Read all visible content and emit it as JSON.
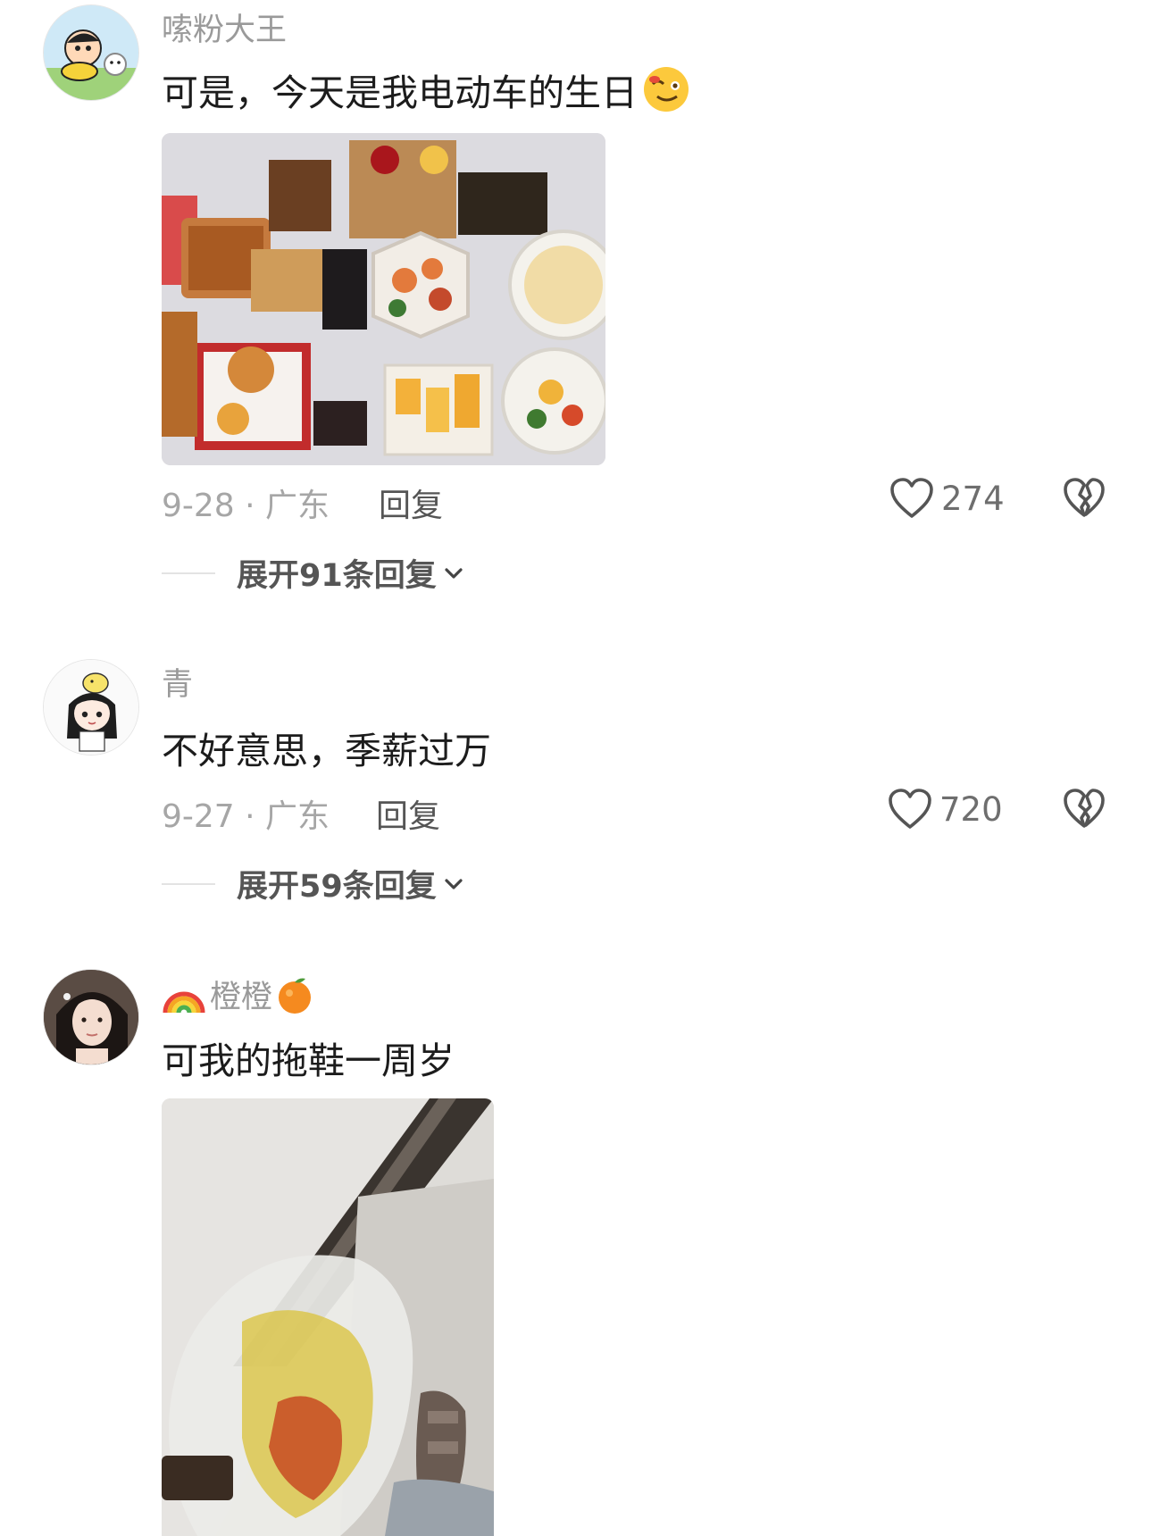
{
  "comments": [
    {
      "username": "嗦粉大王",
      "text": "可是，今天是我电动车的生日",
      "text_emoji": "wink-tongue-emoji",
      "date_location": "9-28 · 广东",
      "reply_label": "回复",
      "likes": "274",
      "expand_label": "展开91条回复"
    },
    {
      "username": "青",
      "text": "不好意思，季薪过万",
      "date_location": "9-27 · 广东",
      "reply_label": "回复",
      "likes": "720",
      "expand_label": "展开59条回复"
    },
    {
      "username": "橙橙",
      "username_prefix_icon": "rainbow-emoji",
      "username_suffix_icon": "orange-emoji",
      "text": "可我的拖鞋一周岁"
    }
  ],
  "icons": {
    "like": "heart-outline-icon",
    "dislike": "broken-heart-icon",
    "expand": "chevron-down-icon"
  }
}
